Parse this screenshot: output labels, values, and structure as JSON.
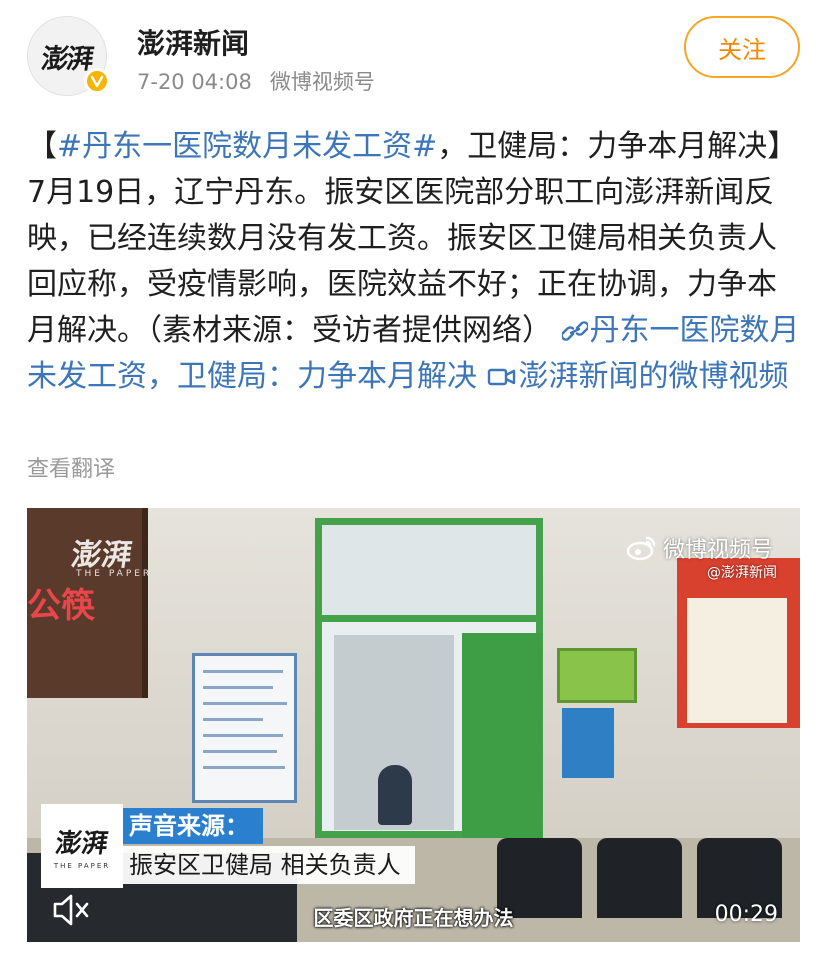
{
  "header": {
    "account_name": "澎湃新闻",
    "avatar_text": "澎湃",
    "timestamp": "7-20 04:08",
    "source": "微博视频号",
    "follow_label": "关注"
  },
  "post": {
    "open_bracket": "【",
    "hashtag": "#丹东一医院数月未发工资#",
    "headline_rest": "，卫健局：力争本月解决】",
    "body": "7月19日，辽宁丹东。振安区医院部分职工向澎湃新闻反映，已经连续数月没有发工资。振安区卫健局相关负责人回应称，受疫情影响，医院效益不好；正在协调，力争本月解决。（素材来源：受访者提供网络）",
    "link_text": "丹东一医院数月未发工资，卫健局：力争本月解决",
    "video_link_text": "澎湃新闻的微博视频",
    "translate_label": "查看翻译"
  },
  "video": {
    "watermark": "澎湃",
    "watermark_sub": "THE PAPER",
    "brand": "微博视频号",
    "handle": "@澎湃新闻",
    "screen_text": "公筷",
    "lower_third_logo": "澎湃",
    "lower_third_logo_sub": "THE PAPER",
    "lower_third_title": "声音来源：",
    "lower_third_subtitle": "振安区卫健局 相关负责人",
    "caption": "区委区政府正在想办法",
    "time": "00:29"
  },
  "colors": {
    "link": "#3d76b8",
    "follow_accent": "#f5a623",
    "verified_badge": "#f7b500",
    "lower_third_blue": "#2b7fcf"
  }
}
